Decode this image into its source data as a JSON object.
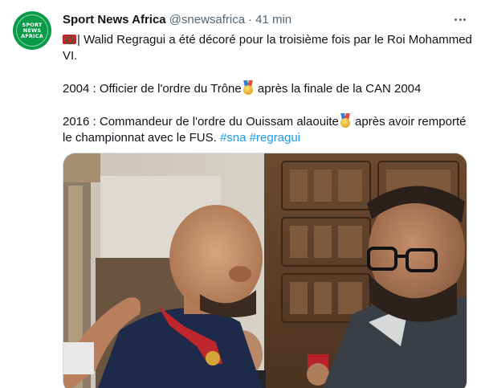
{
  "account": {
    "display_name": "Sport News Africa",
    "handle": "@snewsafrica",
    "time": "41 min",
    "avatar_lines": [
      "SPORT",
      "NEWS",
      "AFRICA"
    ]
  },
  "tweet": {
    "line1_text": "| Walid Regragui a été décoré pour la troisième fois par le Roi Mohammed VI.",
    "line2_before": "2004 : Officier de l'ordre du Trône",
    "line2_after": " après la finale de la CAN 2004",
    "line3_before": "2016 : Commandeur de l'ordre du Ouissam alaouite",
    "line3_after": " après avoir remporté le championnat avec le FUS.",
    "hashtags": [
      "#sna",
      "#regragui"
    ]
  },
  "icons": {
    "flag": "morocco-flag-icon",
    "medal": "sports-medal-icon",
    "more": "more-options-icon"
  },
  "colors": {
    "link": "#1d9bf0",
    "secondary_text": "#536471",
    "avatar_bg": "#0a9b4a"
  }
}
